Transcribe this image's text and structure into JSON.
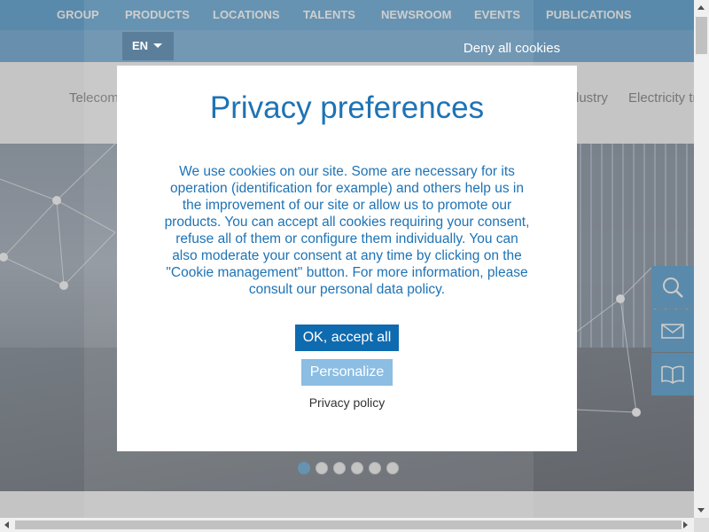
{
  "nav": {
    "items": [
      {
        "label": "GROUP"
      },
      {
        "label": "PRODUCTS"
      },
      {
        "label": "LOCATIONS"
      },
      {
        "label": "TALENTS"
      },
      {
        "label": "NEWSROOM"
      },
      {
        "label": "EVENTS"
      },
      {
        "label": "PUBLICATIONS"
      }
    ]
  },
  "subbar": {
    "language": "EN",
    "deny_label": "Deny all cookies"
  },
  "categories": {
    "left_partial": "Telecom",
    "right_1": "dustry",
    "right_2": "Electricity tr"
  },
  "hero": {
    "slide_count": 6,
    "active_slide": 1
  },
  "side_widgets": [
    {
      "icon": "search-icon"
    },
    {
      "icon": "envelope-icon"
    },
    {
      "icon": "book-icon"
    }
  ],
  "modal": {
    "title": "Privacy preferences",
    "body": "We use cookies on our site. Some are necessary for its operation (identification for example) and others help us in the improvement of our site or allow us to promote our products. You can accept all cookies requiring your consent, refuse all of them or configure them individually. You can also moderate your consent at any time by clicking on the \"Cookie management\" button. For more information, please consult our personal data policy.",
    "accept_label": "OK, accept all",
    "personalize_label": "Personalize",
    "policy_label": "Privacy policy"
  },
  "colors": {
    "brand_blue": "#1d7fc0",
    "accept_blue": "#0f6bb0",
    "personalize_blue": "#8cbde3",
    "title_blue": "#1e73b5"
  }
}
